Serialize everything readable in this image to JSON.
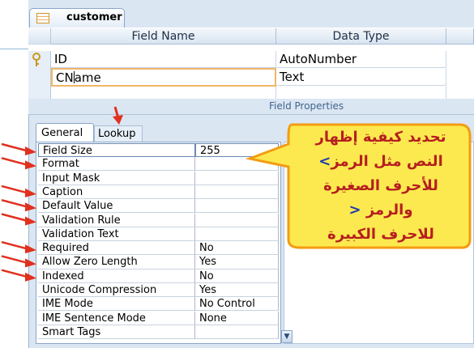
{
  "table_tab": {
    "label": "customer",
    "icon": "table-icon"
  },
  "grid": {
    "headers": {
      "field_name": "Field Name",
      "data_type": "Data Type"
    },
    "rows": [
      {
        "field_name": "ID",
        "data_type": "AutoNumber",
        "primary_key_icon": "key-icon"
      },
      {
        "field_name_before_caret": "CN",
        "field_name_after_caret": "ame",
        "data_type": "Text"
      }
    ]
  },
  "field_properties_label": "Field Properties",
  "property_tabs": {
    "general": "General",
    "lookup": "Lookup"
  },
  "properties": [
    {
      "name": "Field Size",
      "value": "255"
    },
    {
      "name": "Format",
      "value": ""
    },
    {
      "name": "Input Mask",
      "value": ""
    },
    {
      "name": "Caption",
      "value": ""
    },
    {
      "name": "Default Value",
      "value": ""
    },
    {
      "name": "Validation Rule",
      "value": ""
    },
    {
      "name": "Validation Text",
      "value": ""
    },
    {
      "name": "Required",
      "value": "No"
    },
    {
      "name": "Allow Zero Length",
      "value": "Yes"
    },
    {
      "name": "Indexed",
      "value": "No"
    },
    {
      "name": "Unicode Compression",
      "value": "Yes"
    },
    {
      "name": "IME Mode",
      "value": "No Control"
    },
    {
      "name": "IME Sentence Mode",
      "value": "None"
    },
    {
      "name": "Smart Tags",
      "value": ""
    }
  ],
  "callout": {
    "line1": "تحديد كيفية إظهار",
    "line2_a": "النص مثل الرمز",
    "line2_b": ">",
    "line3": "للأحرف الصغيرة",
    "line4_a": "والرمز",
    "line4_b": "<",
    "line5": "للاحرف الكبيرة",
    "fill_color": "#fce94f",
    "border_color": "#f39c12",
    "text_color": "#b51f1f",
    "symbol_color": "#1b3ab0"
  },
  "annotation_arrow_color": "#e0301e"
}
